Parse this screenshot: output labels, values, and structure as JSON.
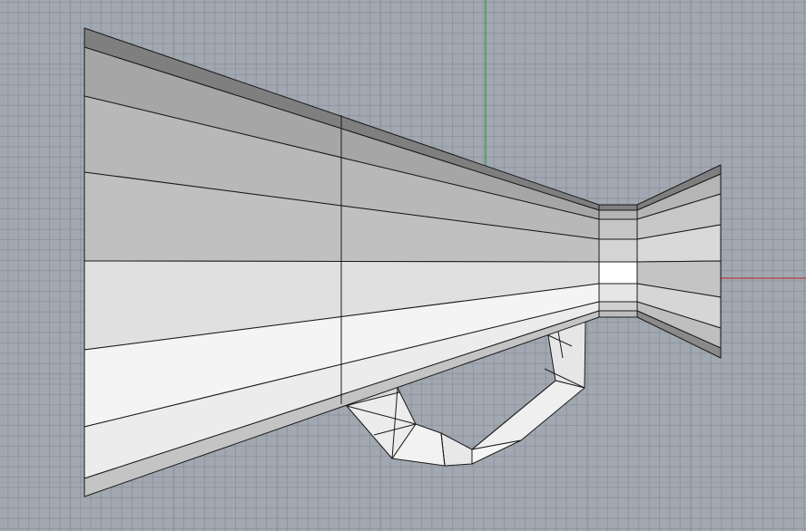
{
  "viewport": {
    "view": "front",
    "display_mode": "shaded",
    "grid": true,
    "grid_color": "#80868f",
    "background_color": "#a1a8b2",
    "x_axis_color": "#b33b3b",
    "y_axis_color": "#3a9a3a"
  },
  "model": {
    "object": "megaphone",
    "parts": [
      "bell",
      "neck",
      "mouthpiece",
      "handle"
    ],
    "edge_color": "#1a1a1a"
  }
}
